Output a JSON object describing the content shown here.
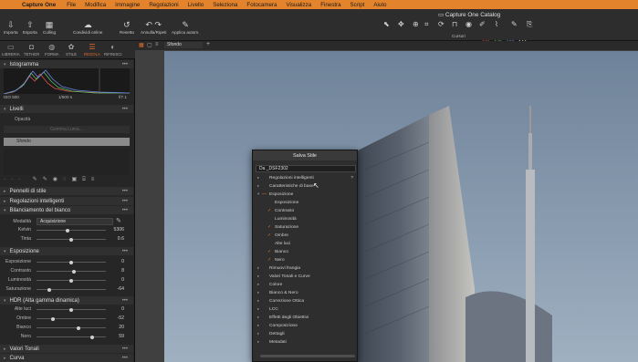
{
  "menubar": {
    "app": "Capture One",
    "items": [
      "File",
      "Modifica",
      "Immagine",
      "Regolazioni",
      "Livello",
      "Seleziona",
      "Fotocamera",
      "Visualizza",
      "Finestra",
      "Script",
      "Aiuto"
    ]
  },
  "toolbar": {
    "buttons": [
      {
        "label": "Importa",
        "icon": "import-icon"
      },
      {
        "label": "Esporta",
        "icon": "export-icon"
      },
      {
        "label": "Culling",
        "icon": "culling-icon"
      },
      {
        "label": "Condividi online",
        "icon": "share-icon"
      },
      {
        "label": "Resetta",
        "icon": "reset-icon"
      },
      {
        "label": "Annulla/Ripeti",
        "icon": "undo-redo-icon"
      },
      {
        "label": "Applica autom.",
        "icon": "auto-adjust-icon"
      }
    ],
    "catalog_title": "Capture One Catalog",
    "cursors_label": "Cursori",
    "rgb": {
      "r": "131",
      "g": "145",
      "b": "168",
      "l": "144"
    },
    "accent": "#e3832c"
  },
  "tool_tabs": [
    {
      "label": "LIBRERIA",
      "icon": "library-icon"
    },
    {
      "label": "TETHER",
      "icon": "tether-icon"
    },
    {
      "label": "FORMA",
      "icon": "lens-icon"
    },
    {
      "label": "STILE",
      "icon": "style-icon"
    },
    {
      "label": "REGOLA",
      "icon": "adjust-icon",
      "active": true
    },
    {
      "label": "RIFINISCI",
      "icon": "refine-icon"
    }
  ],
  "histogram": {
    "title": "Istogramma",
    "iso": "ISO 500",
    "shutter": "1/500 s",
    "aperture": "f/7.1"
  },
  "layers": {
    "title": "Livelli",
    "opacity_label": "Opacità",
    "fill_mask": "Gomma Luma...",
    "background": "Sfondo"
  },
  "sections": {
    "brushes": "Pennelli di stile",
    "smart": "Regolazioni intelligenti",
    "wb": "Bilanciamento del bianco",
    "exposure": "Esposizione",
    "hdr": "HDR (Alta gamma dinamica)",
    "tonal": "Valori Tonali",
    "curve": "Curva"
  },
  "wb": {
    "mode_label": "Modalità",
    "mode_value": "Acquisizione",
    "rows": [
      {
        "label": "Kelvin",
        "value": "5306",
        "pos": 0.45
      },
      {
        "label": "Tinta",
        "value": "0.6",
        "pos": 0.5
      }
    ]
  },
  "exposure": {
    "rows": [
      {
        "label": "Esposizione",
        "value": "0",
        "pos": 0.5
      },
      {
        "label": "Contrasto",
        "value": "8",
        "pos": 0.54
      },
      {
        "label": "Luminosità",
        "value": "0",
        "pos": 0.5
      },
      {
        "label": "Saturazione",
        "value": "-64",
        "pos": 0.18
      }
    ]
  },
  "hdr": {
    "rows": [
      {
        "label": "Alte luci",
        "value": "0",
        "pos": 0.5
      },
      {
        "label": "Ombre",
        "value": "-52",
        "pos": 0.24
      },
      {
        "label": "Bianco",
        "value": "20",
        "pos": 0.6
      },
      {
        "label": "Nero",
        "value": "59",
        "pos": 0.8
      }
    ]
  },
  "viewer_bar": {
    "layer": "Sfondo"
  },
  "dialog": {
    "title": "Salva Stile",
    "name_value": "Da _DSF2302",
    "items": [
      {
        "label": "Regolazioni intelligenti",
        "level": 0,
        "arrow": "▸",
        "count": "?"
      },
      {
        "label": "Caratteristiche di base",
        "level": 0,
        "arrow": "▸"
      },
      {
        "label": "Esposizione",
        "level": 0,
        "arrow": "▾",
        "check": "—"
      },
      {
        "label": "Esposizione",
        "level": 1
      },
      {
        "label": "Contrasto",
        "level": 1,
        "check": "✓"
      },
      {
        "label": "Luminosità",
        "level": 1
      },
      {
        "label": "Saturazione",
        "level": 1,
        "check": "✓"
      },
      {
        "label": "Ombre",
        "level": 1,
        "check": "✓"
      },
      {
        "label": "Alte luci",
        "level": 1
      },
      {
        "label": "Bianco",
        "level": 1,
        "check": "✓"
      },
      {
        "label": "Nero",
        "level": 1,
        "check": "✓"
      },
      {
        "label": "Rimuovi frangia",
        "level": 0,
        "arrow": "▸"
      },
      {
        "label": "Valori Tonali e Curve",
        "level": 0,
        "arrow": "▸"
      },
      {
        "label": "Colore",
        "level": 0,
        "arrow": "▸"
      },
      {
        "label": "Bianco & Nero",
        "level": 0,
        "arrow": "▸"
      },
      {
        "label": "Correzione Ottica",
        "level": 0,
        "arrow": "▸"
      },
      {
        "label": "LCC",
        "level": 0,
        "arrow": "▸"
      },
      {
        "label": "Effetti degli Obiettivi",
        "level": 0,
        "arrow": "▸"
      },
      {
        "label": "Composizione",
        "level": 0,
        "arrow": "▸"
      },
      {
        "label": "Dettagli",
        "level": 0,
        "arrow": "▸"
      },
      {
        "label": "Metadati",
        "level": 0,
        "arrow": "▸"
      }
    ]
  }
}
